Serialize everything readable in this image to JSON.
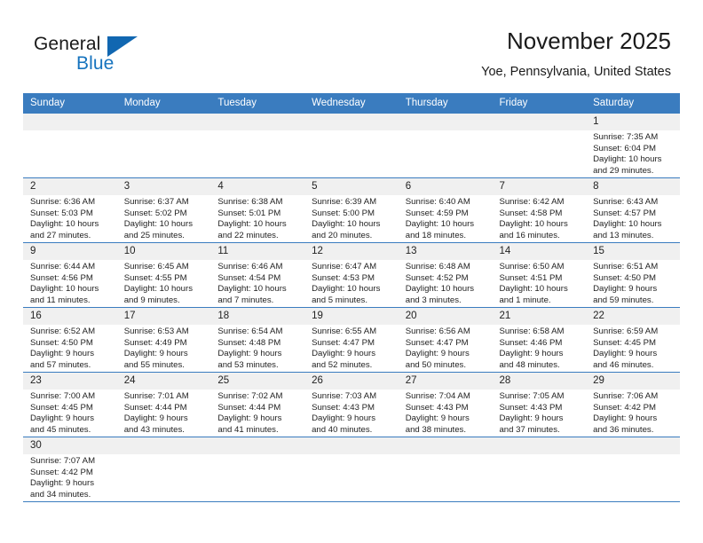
{
  "brand": {
    "name_part1": "General",
    "name_part2": "Blue",
    "logo_icon": "triangle-flag-icon"
  },
  "header": {
    "title": "November 2025",
    "subtitle": "Yoe, Pennsylvania, United States"
  },
  "colors": {
    "header_blue": "#3a7cbf",
    "brand_blue": "#1673be",
    "daynum_band": "#f0f0f0",
    "text": "#1f1f1f"
  },
  "calendar": {
    "weekday_headers": [
      "Sunday",
      "Monday",
      "Tuesday",
      "Wednesday",
      "Thursday",
      "Friday",
      "Saturday"
    ],
    "labels": {
      "sunrise": "Sunrise:",
      "sunset": "Sunset:",
      "daylight": "Daylight:"
    },
    "weeks": [
      [
        {
          "day": "",
          "sunrise": "",
          "sunset": "",
          "daylight": "",
          "daylight2": ""
        },
        {
          "day": "",
          "sunrise": "",
          "sunset": "",
          "daylight": "",
          "daylight2": ""
        },
        {
          "day": "",
          "sunrise": "",
          "sunset": "",
          "daylight": "",
          "daylight2": ""
        },
        {
          "day": "",
          "sunrise": "",
          "sunset": "",
          "daylight": "",
          "daylight2": ""
        },
        {
          "day": "",
          "sunrise": "",
          "sunset": "",
          "daylight": "",
          "daylight2": ""
        },
        {
          "day": "",
          "sunrise": "",
          "sunset": "",
          "daylight": "",
          "daylight2": ""
        },
        {
          "day": "1",
          "sunrise": "Sunrise: 7:35 AM",
          "sunset": "Sunset: 6:04 PM",
          "daylight": "Daylight: 10 hours",
          "daylight2": "and 29 minutes."
        }
      ],
      [
        {
          "day": "2",
          "sunrise": "Sunrise: 6:36 AM",
          "sunset": "Sunset: 5:03 PM",
          "daylight": "Daylight: 10 hours",
          "daylight2": "and 27 minutes."
        },
        {
          "day": "3",
          "sunrise": "Sunrise: 6:37 AM",
          "sunset": "Sunset: 5:02 PM",
          "daylight": "Daylight: 10 hours",
          "daylight2": "and 25 minutes."
        },
        {
          "day": "4",
          "sunrise": "Sunrise: 6:38 AM",
          "sunset": "Sunset: 5:01 PM",
          "daylight": "Daylight: 10 hours",
          "daylight2": "and 22 minutes."
        },
        {
          "day": "5",
          "sunrise": "Sunrise: 6:39 AM",
          "sunset": "Sunset: 5:00 PM",
          "daylight": "Daylight: 10 hours",
          "daylight2": "and 20 minutes."
        },
        {
          "day": "6",
          "sunrise": "Sunrise: 6:40 AM",
          "sunset": "Sunset: 4:59 PM",
          "daylight": "Daylight: 10 hours",
          "daylight2": "and 18 minutes."
        },
        {
          "day": "7",
          "sunrise": "Sunrise: 6:42 AM",
          "sunset": "Sunset: 4:58 PM",
          "daylight": "Daylight: 10 hours",
          "daylight2": "and 16 minutes."
        },
        {
          "day": "8",
          "sunrise": "Sunrise: 6:43 AM",
          "sunset": "Sunset: 4:57 PM",
          "daylight": "Daylight: 10 hours",
          "daylight2": "and 13 minutes."
        }
      ],
      [
        {
          "day": "9",
          "sunrise": "Sunrise: 6:44 AM",
          "sunset": "Sunset: 4:56 PM",
          "daylight": "Daylight: 10 hours",
          "daylight2": "and 11 minutes."
        },
        {
          "day": "10",
          "sunrise": "Sunrise: 6:45 AM",
          "sunset": "Sunset: 4:55 PM",
          "daylight": "Daylight: 10 hours",
          "daylight2": "and 9 minutes."
        },
        {
          "day": "11",
          "sunrise": "Sunrise: 6:46 AM",
          "sunset": "Sunset: 4:54 PM",
          "daylight": "Daylight: 10 hours",
          "daylight2": "and 7 minutes."
        },
        {
          "day": "12",
          "sunrise": "Sunrise: 6:47 AM",
          "sunset": "Sunset: 4:53 PM",
          "daylight": "Daylight: 10 hours",
          "daylight2": "and 5 minutes."
        },
        {
          "day": "13",
          "sunrise": "Sunrise: 6:48 AM",
          "sunset": "Sunset: 4:52 PM",
          "daylight": "Daylight: 10 hours",
          "daylight2": "and 3 minutes."
        },
        {
          "day": "14",
          "sunrise": "Sunrise: 6:50 AM",
          "sunset": "Sunset: 4:51 PM",
          "daylight": "Daylight: 10 hours",
          "daylight2": "and 1 minute."
        },
        {
          "day": "15",
          "sunrise": "Sunrise: 6:51 AM",
          "sunset": "Sunset: 4:50 PM",
          "daylight": "Daylight: 9 hours",
          "daylight2": "and 59 minutes."
        }
      ],
      [
        {
          "day": "16",
          "sunrise": "Sunrise: 6:52 AM",
          "sunset": "Sunset: 4:50 PM",
          "daylight": "Daylight: 9 hours",
          "daylight2": "and 57 minutes."
        },
        {
          "day": "17",
          "sunrise": "Sunrise: 6:53 AM",
          "sunset": "Sunset: 4:49 PM",
          "daylight": "Daylight: 9 hours",
          "daylight2": "and 55 minutes."
        },
        {
          "day": "18",
          "sunrise": "Sunrise: 6:54 AM",
          "sunset": "Sunset: 4:48 PM",
          "daylight": "Daylight: 9 hours",
          "daylight2": "and 53 minutes."
        },
        {
          "day": "19",
          "sunrise": "Sunrise: 6:55 AM",
          "sunset": "Sunset: 4:47 PM",
          "daylight": "Daylight: 9 hours",
          "daylight2": "and 52 minutes."
        },
        {
          "day": "20",
          "sunrise": "Sunrise: 6:56 AM",
          "sunset": "Sunset: 4:47 PM",
          "daylight": "Daylight: 9 hours",
          "daylight2": "and 50 minutes."
        },
        {
          "day": "21",
          "sunrise": "Sunrise: 6:58 AM",
          "sunset": "Sunset: 4:46 PM",
          "daylight": "Daylight: 9 hours",
          "daylight2": "and 48 minutes."
        },
        {
          "day": "22",
          "sunrise": "Sunrise: 6:59 AM",
          "sunset": "Sunset: 4:45 PM",
          "daylight": "Daylight: 9 hours",
          "daylight2": "and 46 minutes."
        }
      ],
      [
        {
          "day": "23",
          "sunrise": "Sunrise: 7:00 AM",
          "sunset": "Sunset: 4:45 PM",
          "daylight": "Daylight: 9 hours",
          "daylight2": "and 45 minutes."
        },
        {
          "day": "24",
          "sunrise": "Sunrise: 7:01 AM",
          "sunset": "Sunset: 4:44 PM",
          "daylight": "Daylight: 9 hours",
          "daylight2": "and 43 minutes."
        },
        {
          "day": "25",
          "sunrise": "Sunrise: 7:02 AM",
          "sunset": "Sunset: 4:44 PM",
          "daylight": "Daylight: 9 hours",
          "daylight2": "and 41 minutes."
        },
        {
          "day": "26",
          "sunrise": "Sunrise: 7:03 AM",
          "sunset": "Sunset: 4:43 PM",
          "daylight": "Daylight: 9 hours",
          "daylight2": "and 40 minutes."
        },
        {
          "day": "27",
          "sunrise": "Sunrise: 7:04 AM",
          "sunset": "Sunset: 4:43 PM",
          "daylight": "Daylight: 9 hours",
          "daylight2": "and 38 minutes."
        },
        {
          "day": "28",
          "sunrise": "Sunrise: 7:05 AM",
          "sunset": "Sunset: 4:43 PM",
          "daylight": "Daylight: 9 hours",
          "daylight2": "and 37 minutes."
        },
        {
          "day": "29",
          "sunrise": "Sunrise: 7:06 AM",
          "sunset": "Sunset: 4:42 PM",
          "daylight": "Daylight: 9 hours",
          "daylight2": "and 36 minutes."
        }
      ],
      [
        {
          "day": "30",
          "sunrise": "Sunrise: 7:07 AM",
          "sunset": "Sunset: 4:42 PM",
          "daylight": "Daylight: 9 hours",
          "daylight2": "and 34 minutes."
        },
        {
          "day": "",
          "sunrise": "",
          "sunset": "",
          "daylight": "",
          "daylight2": ""
        },
        {
          "day": "",
          "sunrise": "",
          "sunset": "",
          "daylight": "",
          "daylight2": ""
        },
        {
          "day": "",
          "sunrise": "",
          "sunset": "",
          "daylight": "",
          "daylight2": ""
        },
        {
          "day": "",
          "sunrise": "",
          "sunset": "",
          "daylight": "",
          "daylight2": ""
        },
        {
          "day": "",
          "sunrise": "",
          "sunset": "",
          "daylight": "",
          "daylight2": ""
        },
        {
          "day": "",
          "sunrise": "",
          "sunset": "",
          "daylight": "",
          "daylight2": ""
        }
      ]
    ]
  }
}
